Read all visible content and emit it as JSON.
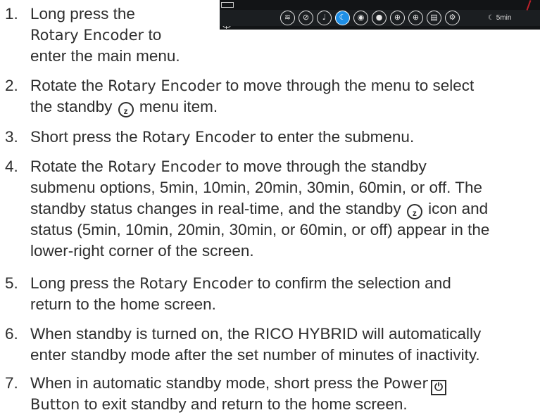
{
  "steps": [
    {
      "n": "1.",
      "lines": [
        [
          "Long press the"
        ],
        [
          "Rotary Encoder",
          " to"
        ],
        [
          "enter the main menu."
        ]
      ]
    },
    {
      "n": "2.",
      "lines": [
        [
          "Rotate the ",
          "Rotary Encoder",
          " to move through the menu to select"
        ],
        [
          "the standby ",
          "menu item."
        ]
      ]
    },
    {
      "n": "3.",
      "lines": [
        [
          "Short press the ",
          "Rotary Encoder",
          " to enter the submenu."
        ]
      ]
    },
    {
      "n": "4.",
      "lines": [
        [
          "Rotate the ",
          "Rotary Encoder",
          " to move through the standby"
        ],
        [
          "submenu options, 5min, 10min, 20min, 30min, 60min, or off. The"
        ],
        [
          "standby status changes in real-time, and the standby ",
          "icon and"
        ],
        [
          "status (5min, 10min, 20min, 30min, or 60min, or off) appear in the"
        ],
        [
          "lower-right corner of the screen."
        ]
      ]
    },
    {
      "n": "5.",
      "lines": [
        [
          "Long press the ",
          "Rotary Encoder",
          " to confirm the selection and"
        ],
        [
          "return to the home screen."
        ]
      ]
    },
    {
      "n": "6.",
      "lines": [
        [
          "When standby is turned on, the RICO HYBRID will automatically"
        ],
        [
          "enter standby mode after the set number of minutes of inactivity."
        ]
      ]
    },
    {
      "n": "7.",
      "lines": [
        [
          "When in automatic standby mode, short press the ",
          "Power"
        ],
        [
          "Button",
          " to exit standby and return to the home screen."
        ]
      ]
    }
  ],
  "screen": {
    "menu_icons": [
      "wifi-icon",
      "compass-icon",
      "microphone-icon",
      "standby-icon",
      "camera-icon",
      "record-icon",
      "crosshair-icon",
      "reticle-icon",
      "gallery-icon",
      "settings-icon"
    ],
    "selected_icon": "standby-icon",
    "standby_badge": "5min",
    "accent_color": "#1f8fe6"
  }
}
